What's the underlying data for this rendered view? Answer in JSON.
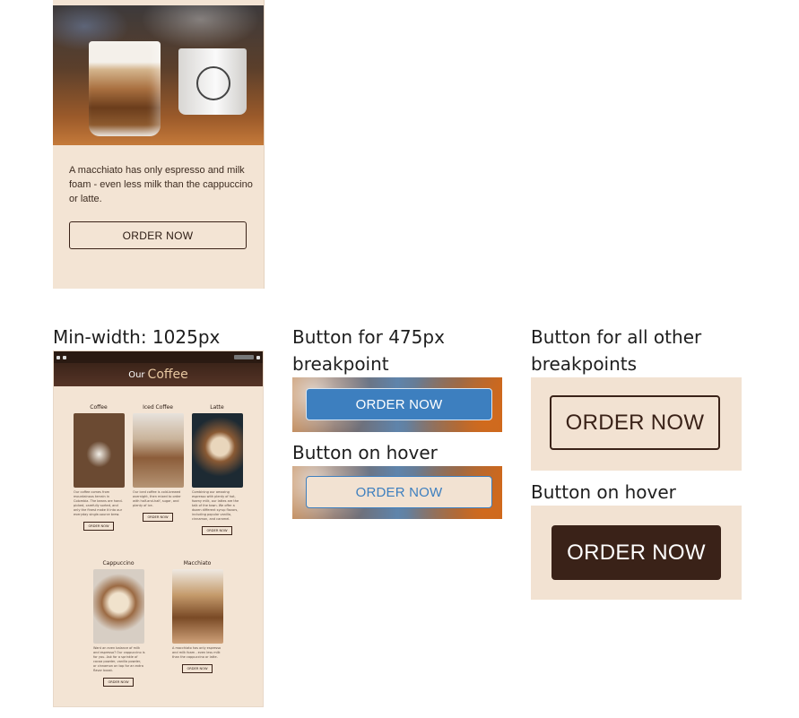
{
  "mobile_card": {
    "description": "A macchiato has only espresso and milk foam - even less milk than the cappuccino or latte.",
    "button": "ORDER NOW"
  },
  "labels": {
    "desktop": "Min-width: 1025px",
    "b475": "Button for 475px breakpoint",
    "b475_hover": "Button on hover",
    "other": "Button for all other breakpoints",
    "other_hover": "Button on hover"
  },
  "desktop_preview": {
    "heading_small": "Our",
    "heading_big": "Coffee",
    "items": [
      {
        "title": "Coffee",
        "text": "Our coffee comes from mountainous terrain in Colombia. The beans are hand-picked, carefully sorted, and only the finest make it into our everyday single-source brew.",
        "button": "ORDER NOW"
      },
      {
        "title": "Iced Coffee",
        "text": "Our iced coffee is cold-brewed overnight, then mixed to order with half-and-half, sugar, and plenty of ice.",
        "button": "ORDER NOW"
      },
      {
        "title": "Latte",
        "text": "Combining our amazing espresso with plenty of hot, foamy milk, our lattes are the talk of the town. We offer a dozen different syrup flavors, including popular vanilla, cinnamon, and caramel.",
        "button": "ORDER NOW"
      },
      {
        "title": "Cappuccino",
        "text": "Want an even balance of milk and espresso? Our cappuccino is for you. Ask for a sprinkle of cocoa powder, vanilla powder, or cinnamon on top for an extra flavor boost.",
        "button": "ORDER NOW"
      },
      {
        "title": "Macchiato",
        "text": "A macchiato has only espresso and milk foam - even less milk than the cappuccino or latte.",
        "button": "ORDER NOW"
      }
    ]
  },
  "buttons": {
    "b475": "ORDER NOW",
    "b475_hover": "ORDER NOW",
    "other": "ORDER NOW",
    "other_hover": "ORDER NOW"
  },
  "colors": {
    "cream": "#f3e4d4",
    "dark_brown": "#3a2218",
    "blue_button": "#3d7fbf",
    "accent_gold": "#e7c7a0"
  }
}
